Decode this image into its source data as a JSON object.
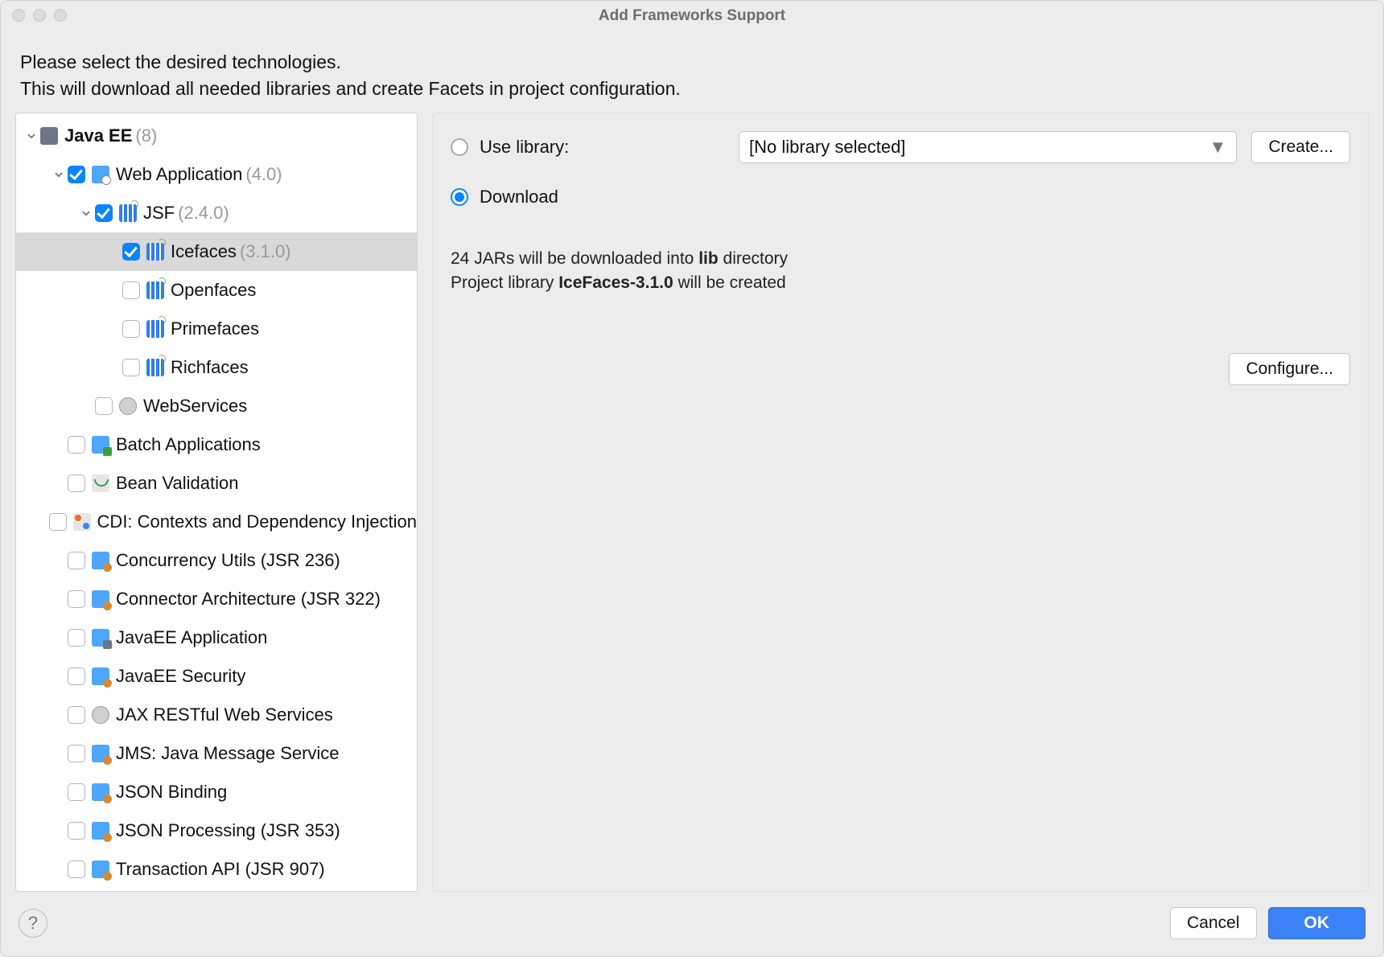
{
  "title": "Add Frameworks Support",
  "intro_line1": "Please select the desired technologies.",
  "intro_line2": "This will download all needed libraries and create Facets in project configuration.",
  "tree": [
    {
      "indent": 0,
      "arrow": "down",
      "checkbox": null,
      "icon": "i-ee",
      "bold": true,
      "label": "Java EE",
      "ver": "(8)",
      "sel": false
    },
    {
      "indent": 1,
      "arrow": "down",
      "checkbox": true,
      "icon": "i-web",
      "bold": false,
      "label": "Web Application",
      "ver": "(4.0)",
      "sel": false
    },
    {
      "indent": 2,
      "arrow": "down",
      "checkbox": true,
      "icon": "i-jsf",
      "bold": false,
      "label": "JSF",
      "ver": "(2.4.0)",
      "sel": false
    },
    {
      "indent": 3,
      "arrow": "",
      "checkbox": true,
      "icon": "i-jsf",
      "bold": false,
      "label": "Icefaces",
      "ver": "(3.1.0)",
      "sel": true
    },
    {
      "indent": 3,
      "arrow": "",
      "checkbox": false,
      "icon": "i-jsf",
      "bold": false,
      "label": "Openfaces",
      "ver": "",
      "sel": false
    },
    {
      "indent": 3,
      "arrow": "",
      "checkbox": false,
      "icon": "i-jsf",
      "bold": false,
      "label": "Primefaces",
      "ver": "",
      "sel": false
    },
    {
      "indent": 3,
      "arrow": "",
      "checkbox": false,
      "icon": "i-jsf",
      "bold": false,
      "label": "Richfaces",
      "ver": "",
      "sel": false
    },
    {
      "indent": 2,
      "arrow": "",
      "checkbox": false,
      "icon": "i-globe",
      "bold": false,
      "label": "WebServices",
      "ver": "",
      "sel": false
    },
    {
      "indent": 1,
      "arrow": "",
      "checkbox": false,
      "icon": "i-batch",
      "bold": false,
      "label": "Batch Applications",
      "ver": "",
      "sel": false
    },
    {
      "indent": 1,
      "arrow": "",
      "checkbox": false,
      "icon": "i-bean",
      "bold": false,
      "label": "Bean Validation",
      "ver": "",
      "sel": false
    },
    {
      "indent": 1,
      "arrow": "",
      "checkbox": false,
      "icon": "i-cdi",
      "bold": false,
      "label": "CDI: Contexts and Dependency Injection",
      "ver": "",
      "sel": false
    },
    {
      "indent": 1,
      "arrow": "",
      "checkbox": false,
      "icon": "i-blue",
      "bold": false,
      "label": "Concurrency Utils (JSR 236)",
      "ver": "",
      "sel": false
    },
    {
      "indent": 1,
      "arrow": "",
      "checkbox": false,
      "icon": "i-blue",
      "bold": false,
      "label": "Connector Architecture (JSR 322)",
      "ver": "",
      "sel": false
    },
    {
      "indent": 1,
      "arrow": "",
      "checkbox": false,
      "icon": "i-eeapp",
      "bold": false,
      "label": "JavaEE Application",
      "ver": "",
      "sel": false
    },
    {
      "indent": 1,
      "arrow": "",
      "checkbox": false,
      "icon": "i-blue",
      "bold": false,
      "label": "JavaEE Security",
      "ver": "",
      "sel": false
    },
    {
      "indent": 1,
      "arrow": "",
      "checkbox": false,
      "icon": "i-globe",
      "bold": false,
      "label": "JAX RESTful Web Services",
      "ver": "",
      "sel": false
    },
    {
      "indent": 1,
      "arrow": "",
      "checkbox": false,
      "icon": "i-blue",
      "bold": false,
      "label": "JMS: Java Message Service",
      "ver": "",
      "sel": false
    },
    {
      "indent": 1,
      "arrow": "",
      "checkbox": false,
      "icon": "i-blue",
      "bold": false,
      "label": "JSON Binding",
      "ver": "",
      "sel": false
    },
    {
      "indent": 1,
      "arrow": "",
      "checkbox": false,
      "icon": "i-blue",
      "bold": false,
      "label": "JSON Processing (JSR 353)",
      "ver": "",
      "sel": false
    },
    {
      "indent": 1,
      "arrow": "",
      "checkbox": false,
      "icon": "i-blue",
      "bold": false,
      "label": "Transaction API (JSR 907)",
      "ver": "",
      "sel": false
    }
  ],
  "detail": {
    "use_library_label": "Use library:",
    "library_selected": "[No library selected]",
    "create_btn": "Create...",
    "download_label": "Download",
    "info_jars_count": "24",
    "info_jars_text1": " JARs will be downloaded into ",
    "info_jars_dir": "lib",
    "info_jars_text2": " directory",
    "info_proj_text1": "Project library ",
    "info_proj_lib": "IceFaces-3.1.0",
    "info_proj_text2": " will be created",
    "configure_btn": "Configure..."
  },
  "footer": {
    "help": "?",
    "cancel": "Cancel",
    "ok": "OK"
  }
}
